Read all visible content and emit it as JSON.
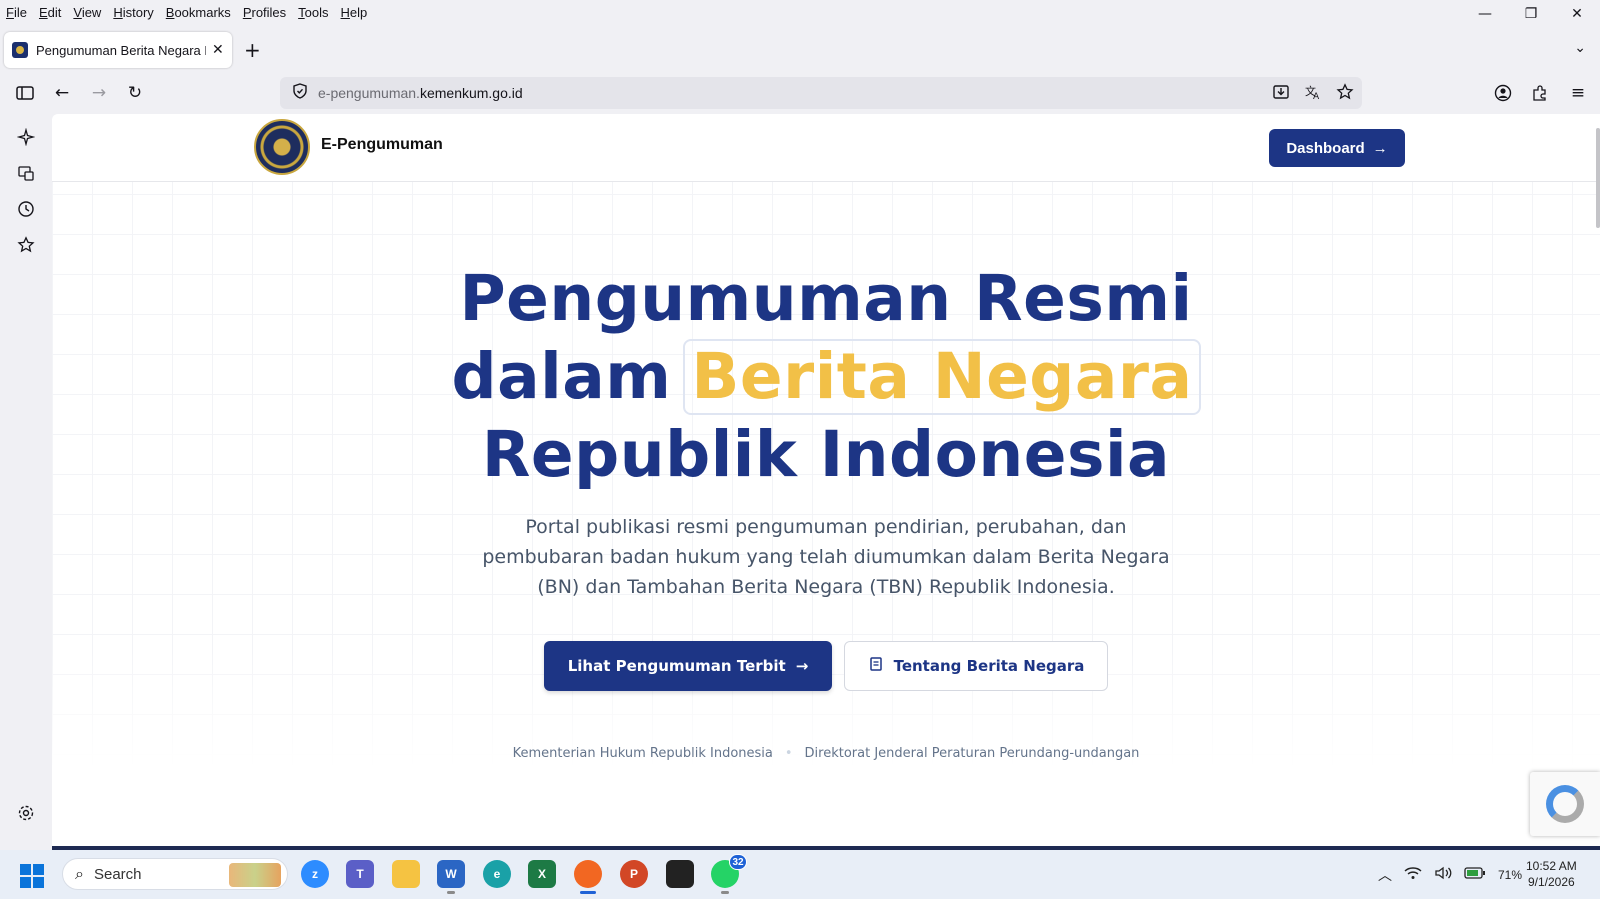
{
  "browser": {
    "menu": [
      "File",
      "Edit",
      "View",
      "History",
      "Bookmarks",
      "Profiles",
      "Tools",
      "Help"
    ],
    "window_controls": {
      "minimize": "—",
      "restore": "❐",
      "close": "✕"
    },
    "tab": {
      "title": "Pengumuman Berita Negara RI",
      "close": "✕"
    },
    "new_tab": "+",
    "tab_list": "⌄",
    "url": {
      "prefix": "e-pengumuman.",
      "domain": "kemenkum.go.id"
    },
    "icons": {
      "sidebar_toggle": "sidebar-icon",
      "back": "back-arrow-icon",
      "forward": "forward-arrow-icon",
      "reload": "reload-icon",
      "shield": "shield-icon",
      "save": "save-to-pocket-icon",
      "translate": "translate-icon",
      "bookmark": "star-icon",
      "account": "account-icon",
      "extensions": "extensions-icon",
      "menu": "hamburger-menu-icon"
    }
  },
  "sidebar": {
    "items": [
      "ai-chat-icon",
      "synced-tabs-icon",
      "history-icon",
      "bookmarks-icon"
    ],
    "settings": "gear-icon"
  },
  "site": {
    "brand": "E-Pengumuman",
    "dashboard_label": "Dashboard",
    "arrow": "→",
    "hero": {
      "line1": "Pengumuman Resmi",
      "line2_prefix": "dalam",
      "line2_highlight": "Berita Negara",
      "line3": "Republik Indonesia"
    },
    "subtitle": {
      "line1": "Portal publikasi resmi pengumuman pendirian, perubahan, dan",
      "line2": "pembubaran badan hukum yang telah diumumkan dalam Berita Negara",
      "line3": "(BN) dan Tambahan Berita Negara (TBN) Republik Indonesia."
    },
    "cta_primary": "Lihat Pengumuman Terbit",
    "cta_secondary": "Tentang Berita Negara",
    "cta_secondary_icon": "scroll-icon",
    "footer": {
      "left": "Kementerian Hukum Republik Indonesia",
      "sep": "•",
      "right": "Direktorat Jenderal Peraturan Perundang-undangan"
    },
    "colors": {
      "primary": "#1d3585",
      "accent": "#f2c047"
    }
  },
  "taskbar": {
    "search_label": "Search",
    "apps": [
      "zoom",
      "teams",
      "file-explorer",
      "word",
      "edge",
      "excel",
      "firefox",
      "powerpoint",
      "sticky-notes",
      "whatsapp"
    ],
    "whatsapp_badge": "32",
    "battery": "71%",
    "time": "10:52 AM",
    "date": "9/1/2026"
  }
}
